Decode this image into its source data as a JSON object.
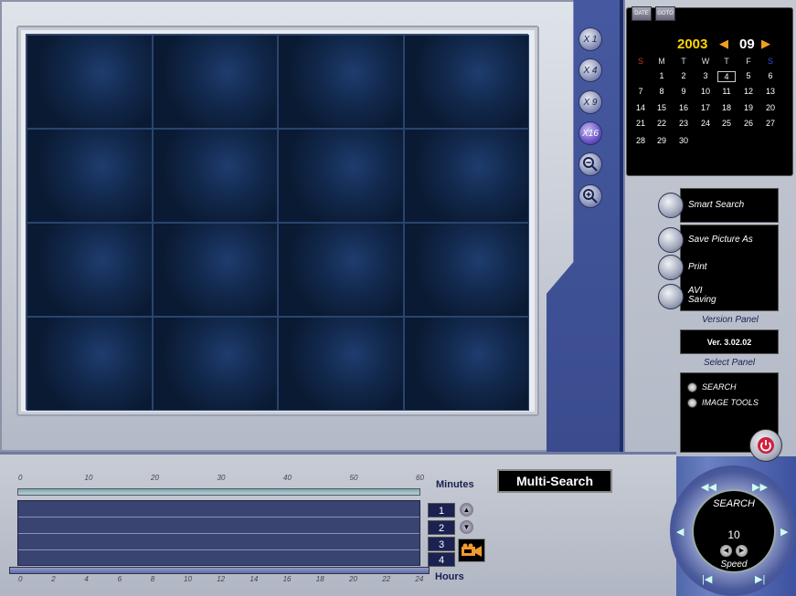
{
  "zoom_buttons": [
    "X 1",
    "X 4",
    "X 9",
    "X16"
  ],
  "calendar": {
    "date_btn": "DATE",
    "goto_btn": "GOTO",
    "year": "2003",
    "month": "09",
    "weekdays": [
      "S",
      "M",
      "T",
      "W",
      "T",
      "F",
      "S"
    ],
    "weeks": [
      [
        "",
        "1",
        "2",
        "3",
        "4",
        "5",
        "6"
      ],
      [
        "7",
        "8",
        "9",
        "10",
        "11",
        "12",
        "13"
      ],
      [
        "14",
        "15",
        "16",
        "17",
        "18",
        "19",
        "20"
      ],
      [
        "21",
        "22",
        "23",
        "24",
        "25",
        "26",
        "27"
      ],
      [
        "28",
        "29",
        "30",
        "",
        "",
        "",
        ""
      ]
    ],
    "selected_day": "4"
  },
  "menu": {
    "smart_search": "Smart Search",
    "save_picture": "Save Picture As",
    "print": "Print",
    "avi_line1": "AVI",
    "avi_line2": "Saving"
  },
  "version_panel": {
    "label": "Version Panel",
    "value": "Ver. 3.02.02"
  },
  "select_panel": {
    "label": "Select Panel",
    "options": [
      "SEARCH",
      "IMAGE TOOLS"
    ]
  },
  "timeline": {
    "minutes_label": "Minutes",
    "hours_label": "Hours",
    "minute_ticks": [
      "0",
      "10",
      "20",
      "30",
      "40",
      "50",
      "60"
    ],
    "hour_ticks": [
      "0",
      "2",
      "4",
      "6",
      "8",
      "10",
      "12",
      "14",
      "16",
      "18",
      "20",
      "22",
      "24"
    ],
    "channels": [
      "1",
      "2",
      "3",
      "4"
    ]
  },
  "mode_title": "Multi-Search",
  "jog": {
    "title": "SEARCH",
    "speed_value": "10",
    "speed_label": "Speed"
  },
  "colors": {
    "year": "#ffd400",
    "accent": "#f0a020",
    "sunday": "#d03030",
    "saturday": "#3050d0"
  }
}
